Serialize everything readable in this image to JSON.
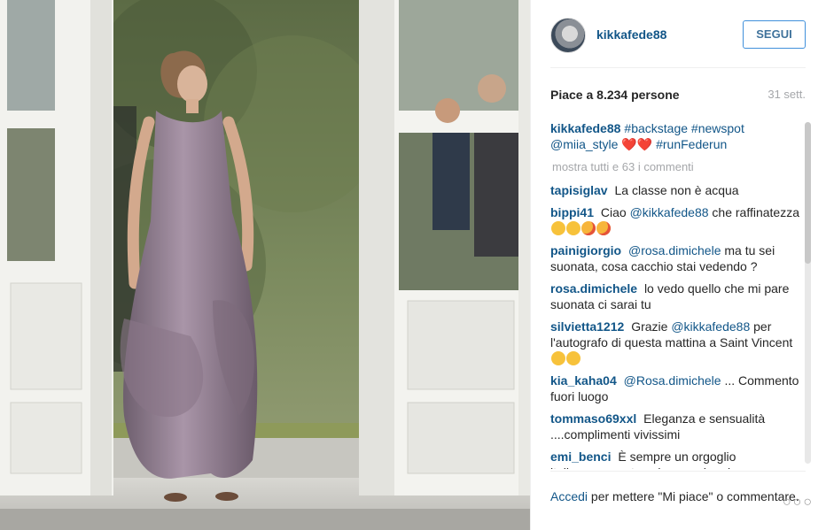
{
  "post": {
    "username": "kikkafede88",
    "follow_label": "SEGUI",
    "likes_label": "Piace a 8.234 persone",
    "age_label": "31 sett.",
    "caption": {
      "user": "kikkafede88",
      "text_parts": [
        "#backstage",
        "#newspot",
        "@miia_style",
        "❤️❤️",
        "#runFederun"
      ]
    },
    "show_all_label": "mostra tutti e 63 i commenti",
    "comments": [
      {
        "user": "tapisiglav",
        "text": "La classe non è acqua"
      },
      {
        "user": "bippi41",
        "text_a": "Ciao",
        "mention": "@kikkafede88",
        "text_b": "che raffinatezza"
      },
      {
        "user": "painigiorgio",
        "mention": "@rosa.dimichele",
        "text_b": "ma tu sei suonata, cosa cacchio stai vedendo ?"
      },
      {
        "user": "rosa.dimichele",
        "text": "lo vedo quello che mi pare suonata ci sarai tu"
      },
      {
        "user": "silvietta1212",
        "text_a": "Grazie",
        "mention": "@kikkafede88",
        "text_b": "per l'autografo di questa mattina a Saint Vincent"
      },
      {
        "user": "kia_kaha04",
        "mention": "@Rosa.dimichele",
        "text_b": "... Commento fuori luogo"
      },
      {
        "user": "tommaso69xxl",
        "text": "Eleganza e sensualità ....complimenti vivissimi"
      },
      {
        "user": "emi_benci",
        "text": "È sempre un orgoglio italiano...provate voi a prendere le sue"
      }
    ],
    "footer": {
      "login_link": "Accedi",
      "text": "per mettere \"Mi piace\" o commentare."
    },
    "more_icon": "more-icon"
  }
}
